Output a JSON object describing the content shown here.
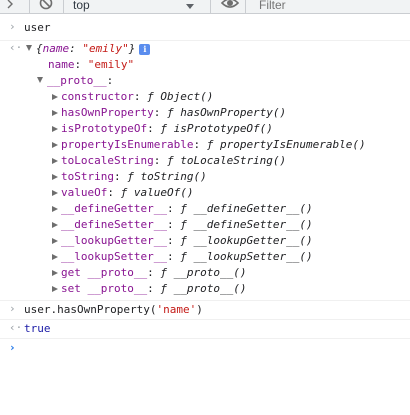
{
  "toolbar": {
    "context": "top",
    "filter_placeholder": "Filter",
    "icons": [
      "clear-console-icon",
      "block-icon",
      "context-dropdown-arrow-icon",
      "eye-icon"
    ]
  },
  "console": {
    "input1": "user",
    "object_preview": "{name: \"emily\"}",
    "object_preview_parts": {
      "open": "{",
      "key": "name",
      "sep": ": ",
      "value": "\"emily\"",
      "close": "}"
    },
    "name_prop": {
      "key": "name",
      "sep": ": ",
      "value": "\"emily\""
    },
    "proto_label": "__proto__",
    "proto_sep": ":",
    "proto_props": [
      {
        "key": "constructor",
        "value": "ƒ Object()"
      },
      {
        "key": "hasOwnProperty",
        "value": "ƒ hasOwnProperty()"
      },
      {
        "key": "isPrototypeOf",
        "value": "ƒ isPrototypeOf()"
      },
      {
        "key": "propertyIsEnumerable",
        "value": "ƒ propertyIsEnumerable()"
      },
      {
        "key": "toLocaleString",
        "value": "ƒ toLocaleString()"
      },
      {
        "key": "toString",
        "value": "ƒ toString()"
      },
      {
        "key": "valueOf",
        "value": "ƒ valueOf()"
      },
      {
        "key": "__defineGetter__",
        "value": "ƒ __defineGetter__()"
      },
      {
        "key": "__defineSetter__",
        "value": "ƒ __defineSetter__()"
      },
      {
        "key": "__lookupGetter__",
        "value": "ƒ __lookupGetter__()"
      },
      {
        "key": "__lookupSetter__",
        "value": "ƒ __lookupSetter__()"
      },
      {
        "key": "get __proto__",
        "value": "ƒ __proto__()"
      },
      {
        "key": "set __proto__",
        "value": "ƒ __proto__()"
      }
    ],
    "input2_parts": {
      "call": "user.hasOwnProperty(",
      "arg": "'name'",
      "close": ")"
    },
    "result2": "true",
    "info_badge": "i"
  },
  "colors": {
    "key": "#881391",
    "string": "#c41a16",
    "boolean": "#1a1aa6",
    "prompt": "#1a73e8"
  }
}
